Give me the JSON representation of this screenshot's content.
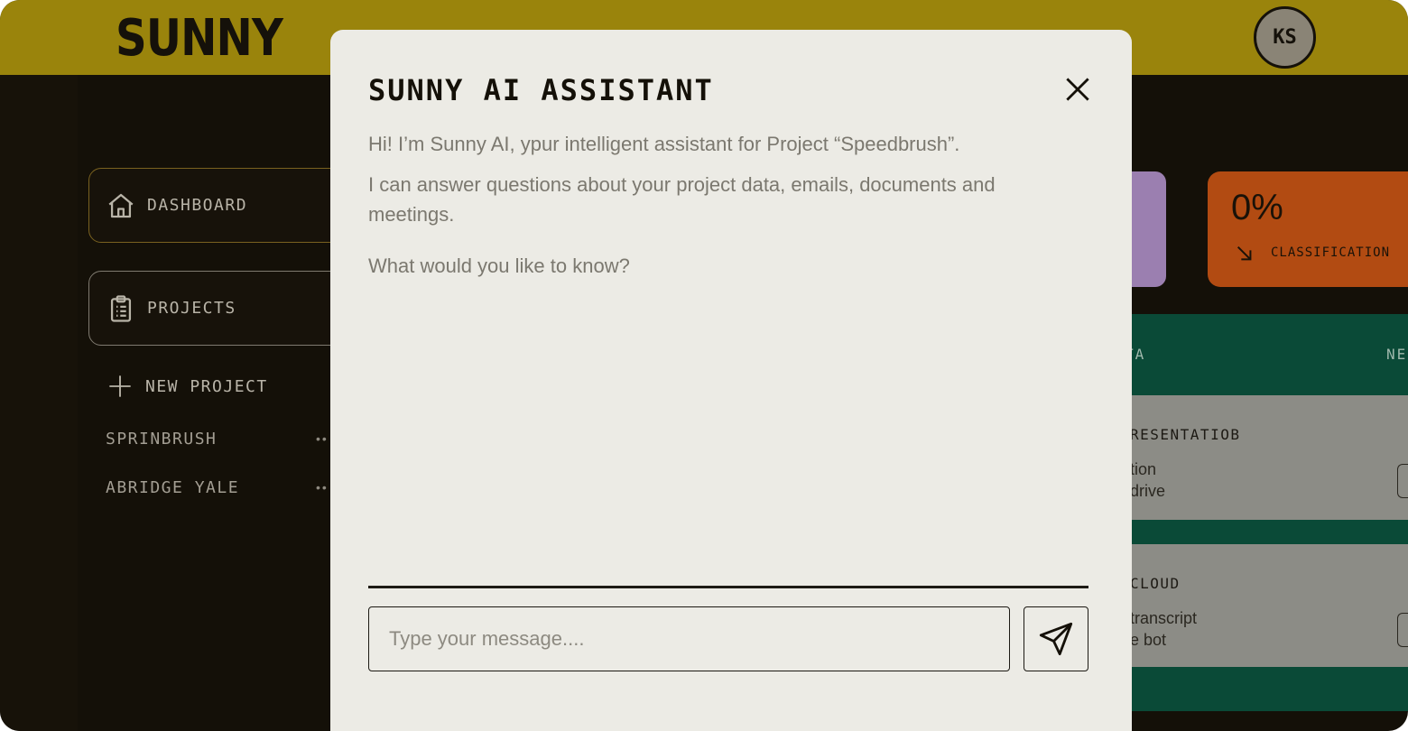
{
  "header": {
    "logo": "SUNNY",
    "avatar_initials": "KS"
  },
  "sidebar": {
    "dashboard_label": "DASHBOARD",
    "projects_label": "PROJECTS",
    "new_project_label": "NEW PROJECT",
    "projects": [
      {
        "name": "SPRINBRUSH",
        "more": "••"
      },
      {
        "name": "ABRIDGE YALE",
        "more": "••"
      }
    ]
  },
  "stats": {
    "classification_value": "0%",
    "classification_label": "CLASSIFICATION"
  },
  "table": {
    "columns": [
      "TA",
      "NE"
    ],
    "rows": [
      {
        "title": "RESENTATIOB",
        "line1": "tion",
        "line2": "drive"
      },
      {
        "title": "CLOUD",
        "line1": "transcript",
        "line2": "e bot"
      }
    ]
  },
  "assistant": {
    "title": "SUNNY AI ASSISTANT",
    "greeting": "Hi! I’m Sunny AI, ypur intelligent assistant for Project “Speedbrush”.",
    "capabilities": "I can answer questions about your project data, emails, documents and meetings.",
    "prompt": "What would you like to know?",
    "input_placeholder": "Type your message....",
    "input_value": ""
  },
  "colors": {
    "header": "#9a840c",
    "modal_bg": "#ecebe5",
    "orange_card": "#b24b12",
    "purple_card": "#9b7fb0",
    "green_panel": "#0a4a37",
    "page_bg": "#141008"
  },
  "icons": [
    "home-icon",
    "clipboard-icon",
    "plus-icon",
    "arrow-down-right-icon",
    "close-icon",
    "send-icon"
  ]
}
